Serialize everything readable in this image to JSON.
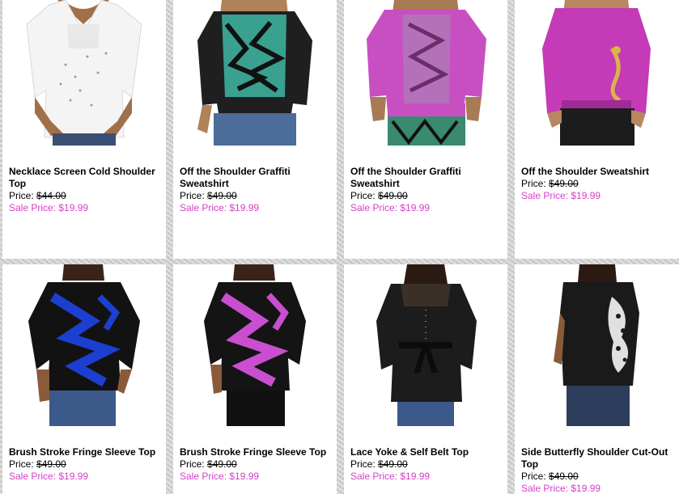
{
  "products": [
    {
      "name": "Necklace Screen Cold Shoulder Top",
      "price_label": "Price:",
      "price": "$44.00",
      "sale_label": "Sale Price:",
      "sale_price": "$19.99",
      "image": "white-v-neck-cold-shoulder-top"
    },
    {
      "name": "Off the Shoulder Graffiti Sweatshirt",
      "price_label": "Price:",
      "price": "$49.00",
      "sale_label": "Sale Price:",
      "sale_price": "$19.99",
      "image": "black-teal-graffiti-sweatshirt"
    },
    {
      "name": "Off the Shoulder Graffiti Sweatshirt",
      "price_label": "Price:",
      "price": "$49.00",
      "sale_label": "Sale Price:",
      "sale_price": "$19.99",
      "image": "pink-graffiti-sweatshirt"
    },
    {
      "name": "Off the Shoulder Sweatshirt",
      "price_label": "Price:",
      "price": "$49.00",
      "sale_label": "Sale Price:",
      "sale_price": "$19.99",
      "image": "magenta-sweatshirt"
    },
    {
      "name": "Brush Stroke Fringe Sleeve Top",
      "price_label": "Price:",
      "price": "$49.00",
      "sale_label": "Sale Price:",
      "sale_price": "$19.99",
      "image": "blue-black-brush-stroke-top"
    },
    {
      "name": "Brush Stroke Fringe Sleeve Top",
      "price_label": "Price:",
      "price": "$49.00",
      "sale_label": "Sale Price:",
      "sale_price": "$19.99",
      "image": "pink-black-brush-stroke-top"
    },
    {
      "name": "Lace Yoke & Self Belt Top",
      "price_label": "Price:",
      "price": "$49.00",
      "sale_label": "Sale Price:",
      "sale_price": "$19.99",
      "image": "black-lace-yoke-belted-top"
    },
    {
      "name": "Side Butterfly Shoulder Cut-Out Top",
      "price_label": "Price:",
      "price": "$49.00",
      "sale_label": "Sale Price:",
      "sale_price": "$19.99",
      "image": "black-butterfly-print-top"
    }
  ],
  "colors": {
    "sale": "#d63fc8",
    "card": "#ffffff",
    "page_bg": "#d6d6d6"
  }
}
